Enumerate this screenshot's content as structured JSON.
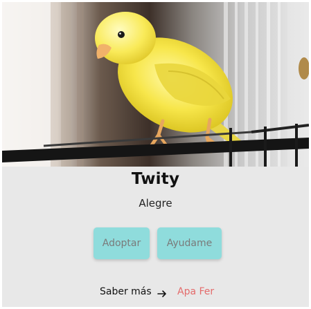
{
  "pet": {
    "name": "Twity",
    "mood": "Alegre"
  },
  "buttons": {
    "adopt_label": "Adoptar",
    "help_label": "Ayudame"
  },
  "footer": {
    "more_label": "Saber más",
    "author": "Apa Fer"
  },
  "colors": {
    "card_background": "#e8e8e8",
    "button_background": "#8fdcdc",
    "button_text": "#7a7a7a",
    "author_text": "#e46b6b"
  },
  "icons": {
    "more_arrow": "arrow-right-icon"
  }
}
